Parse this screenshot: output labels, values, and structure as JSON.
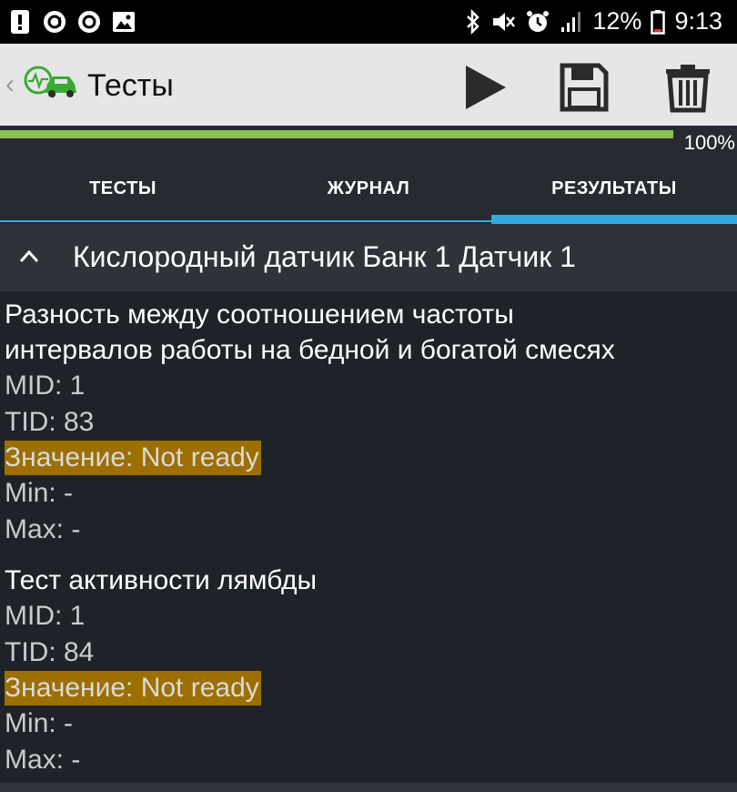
{
  "status_bar": {
    "battery": "12%",
    "time": "9:13"
  },
  "app_bar": {
    "title": "Тесты",
    "icons": [
      "back-chevron-icon",
      "car-diagnostic-logo",
      "play-icon",
      "save-icon",
      "trash-icon"
    ]
  },
  "progress": {
    "label": "100%",
    "value": 1.0,
    "fill_color": "#8cc152"
  },
  "tabs": [
    {
      "label": "ТЕСТЫ",
      "active": false
    },
    {
      "label": "ЖУРНАЛ",
      "active": false
    },
    {
      "label": "РЕЗУЛЬТАТЫ",
      "active": true
    }
  ],
  "accent_color": "#33a8e0",
  "highlight_color": "#9c6f00",
  "section": {
    "title": "Кислородный датчик Банк 1 Датчик 1",
    "expanded": true
  },
  "results": [
    {
      "name_line1": "Разность между соотношением частоты",
      "name_line2": "интервалов работы на бедной и богатой смесях",
      "mid": "MID: 1",
      "tid": "TID: 83",
      "value": "Значение: Not ready",
      "min": "Min:  -",
      "max": "Max:  -"
    },
    {
      "name_line1": "Тест активности лямбды",
      "mid": "MID: 1",
      "tid": "TID: 84",
      "value": "Значение: Not ready",
      "min": "Min:  -",
      "max": "Max:  -"
    }
  ]
}
